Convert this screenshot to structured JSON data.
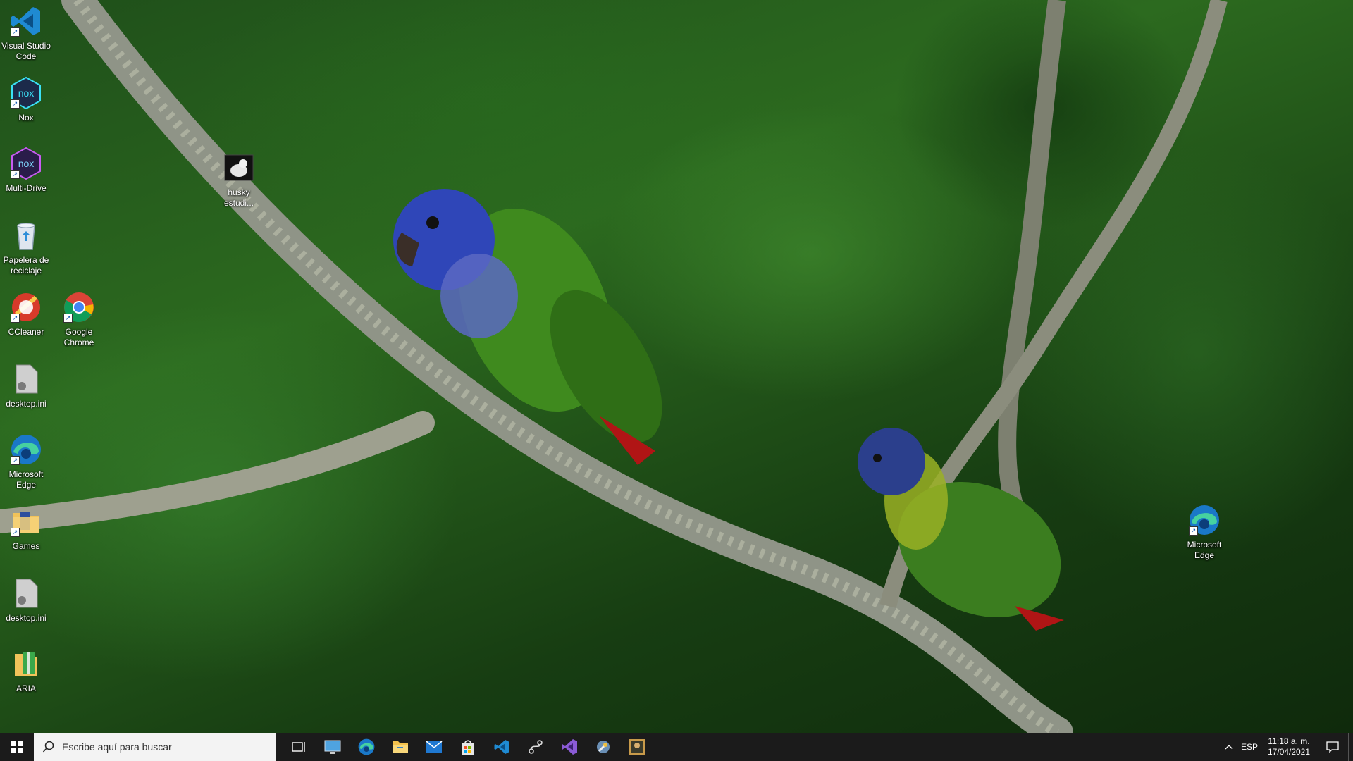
{
  "desktop": {
    "icons": [
      {
        "label": "Visual Studio Code",
        "icon": "vscode-icon"
      },
      {
        "label": "Nox",
        "icon": "nox-icon"
      },
      {
        "label": "Multi-Drive",
        "icon": "nox-multidrive-icon"
      },
      {
        "label": "Papelera de reciclaje",
        "icon": "recycle-bin-icon"
      },
      {
        "label": "CCleaner",
        "icon": "ccleaner-icon"
      },
      {
        "label": "Google Chrome",
        "icon": "chrome-icon"
      },
      {
        "label": "desktop.ini",
        "icon": "ini-file-icon"
      },
      {
        "label": "Microsoft Edge",
        "icon": "edge-icon"
      },
      {
        "label": "Games",
        "icon": "folder-icon"
      },
      {
        "label": "desktop.ini",
        "icon": "ini-file-icon"
      },
      {
        "label": "ARIA",
        "icon": "archive-icon"
      },
      {
        "label": "husky estudi...",
        "icon": "image-file-icon"
      },
      {
        "label": "Microsoft Edge",
        "icon": "edge-icon"
      }
    ]
  },
  "taskbar": {
    "search_placeholder": "Escribe aquí para buscar",
    "pinned": [
      {
        "name": "task-view",
        "icon": "task-view-icon"
      },
      {
        "name": "explorer-app",
        "icon": "computer-icon"
      },
      {
        "name": "edge",
        "icon": "edge-icon"
      },
      {
        "name": "file-explorer",
        "icon": "folder-icon"
      },
      {
        "name": "mail",
        "icon": "mail-icon"
      },
      {
        "name": "store",
        "icon": "store-icon"
      },
      {
        "name": "vscode",
        "icon": "vscode-icon"
      },
      {
        "name": "git-tool",
        "icon": "git-icon"
      },
      {
        "name": "visual-studio",
        "icon": "visual-studio-icon"
      },
      {
        "name": "tool",
        "icon": "wrench-icon"
      },
      {
        "name": "image-viewer",
        "icon": "image-icon"
      }
    ],
    "tray": {
      "language": "ESP",
      "time": "11:18 a. m.",
      "date": "17/04/2021"
    }
  },
  "colors": {
    "taskbar_bg": "#1b1b1b",
    "accent": "#7fb1e6"
  }
}
